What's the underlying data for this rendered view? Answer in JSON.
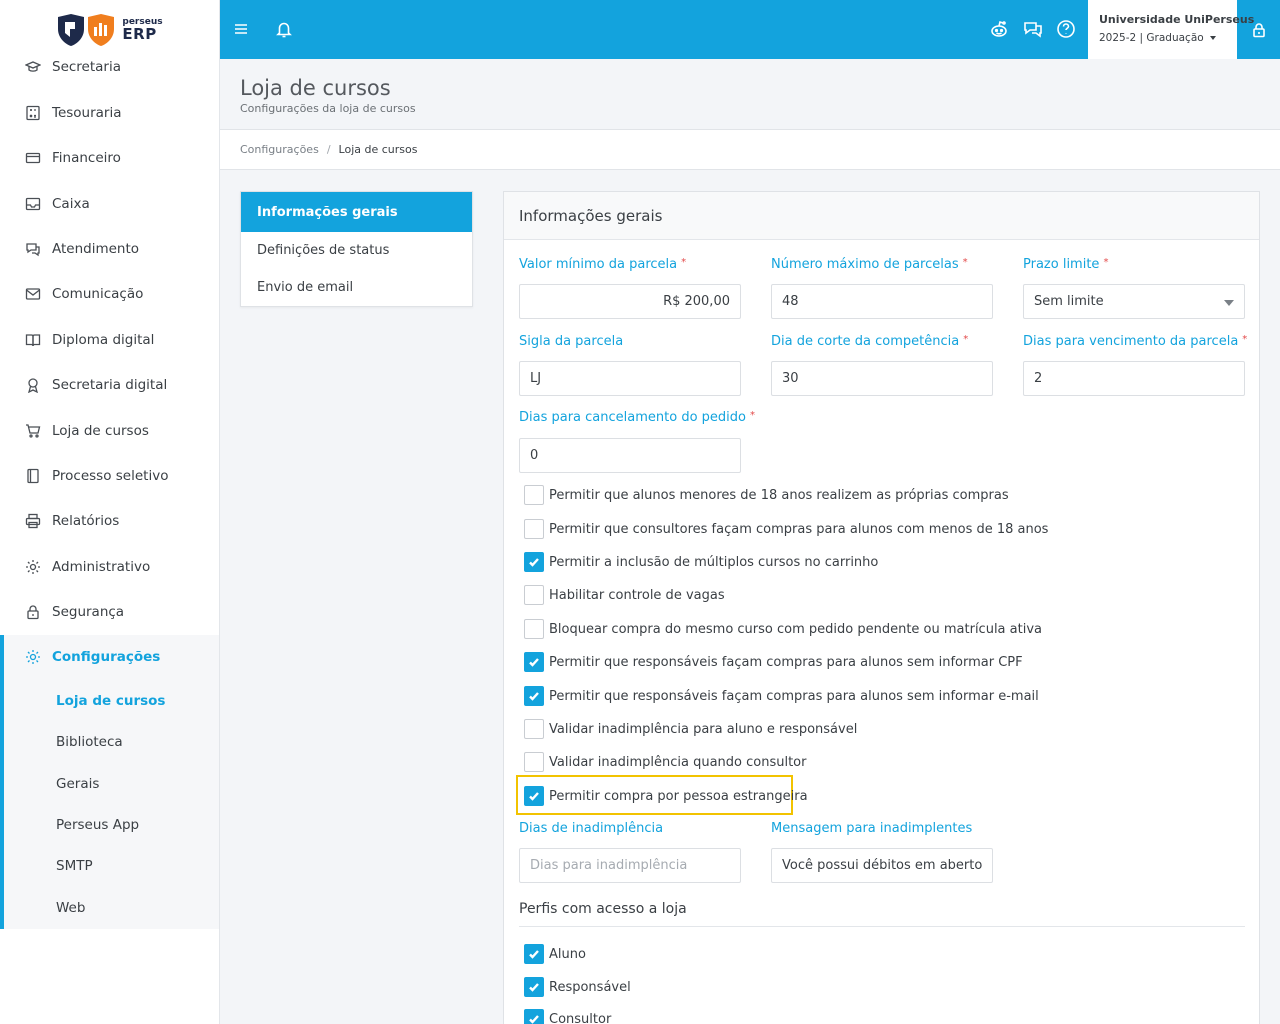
{
  "brand": {
    "small": "perseus",
    "big": "ERP"
  },
  "sidebar": {
    "items": [
      {
        "label": "Secretaria",
        "icon": "graduation-cap-icon"
      },
      {
        "label": "Tesouraria",
        "icon": "calculator-icon"
      },
      {
        "label": "Financeiro",
        "icon": "credit-card-icon"
      },
      {
        "label": "Caixa",
        "icon": "inbox-icon"
      },
      {
        "label": "Atendimento",
        "icon": "chat-icon"
      },
      {
        "label": "Comunicação",
        "icon": "envelope-icon"
      },
      {
        "label": "Diploma digital",
        "icon": "book-icon"
      },
      {
        "label": "Secretaria digital",
        "icon": "award-icon"
      },
      {
        "label": "Loja de cursos",
        "icon": "cart-icon"
      },
      {
        "label": "Processo seletivo",
        "icon": "notebook-icon"
      },
      {
        "label": "Relatórios",
        "icon": "printer-icon"
      },
      {
        "label": "Administrativo",
        "icon": "gear-icon"
      },
      {
        "label": "Segurança",
        "icon": "lock-icon"
      },
      {
        "label": "Configurações",
        "icon": "gear-icon"
      }
    ],
    "subitems": [
      "Loja de cursos",
      "Biblioteca",
      "Gerais",
      "Perseus App",
      "SMTP",
      "Web"
    ]
  },
  "topbar": {
    "university": "Universidade UniPerseus",
    "term": "2025-2 | Graduação"
  },
  "page": {
    "title": "Loja de cursos",
    "subtitle": "Configurações da loja de cursos"
  },
  "breadcrumb": {
    "parent": "Configurações",
    "current": "Loja de cursos"
  },
  "tabs": [
    "Informações gerais",
    "Definições de status",
    "Envio de email"
  ],
  "form": {
    "header": "Informações gerais",
    "fields": {
      "valor_minimo": {
        "label": "Valor mínimo da parcela",
        "value": "R$ 200,00"
      },
      "numero_maximo": {
        "label": "Número máximo de parcelas",
        "value": "48"
      },
      "prazo_limite": {
        "label": "Prazo limite",
        "value": "Sem limite"
      },
      "sigla": {
        "label": "Sigla da parcela",
        "value": "LJ"
      },
      "dia_corte": {
        "label": "Dia de corte da competência",
        "value": "30"
      },
      "dias_vencimento": {
        "label": "Dias para vencimento da parcela",
        "value": "2"
      },
      "dias_cancelamento": {
        "label": "Dias para cancelamento do pedido",
        "value": "0"
      },
      "dias_inadimplencia": {
        "label": "Dias de inadimplência",
        "value": "",
        "placeholder": "Dias para inadimplência"
      },
      "mensagem_inadimplentes": {
        "label": "Mensagem para inadimplentes",
        "value": "Você possui débitos em aberto, ..."
      }
    },
    "required_mark": "*",
    "checkboxes": [
      {
        "label": "Permitir que alunos menores de 18 anos realizem as próprias compras",
        "checked": false
      },
      {
        "label": "Permitir que consultores façam compras para alunos com menos de 18 anos",
        "checked": false
      },
      {
        "label": "Permitir a inclusão de múltiplos cursos no carrinho",
        "checked": true
      },
      {
        "label": "Habilitar controle de vagas",
        "checked": false
      },
      {
        "label": "Bloquear compra do mesmo curso com pedido pendente ou matrícula ativa",
        "checked": false
      },
      {
        "label": "Permitir que responsáveis façam compras para alunos sem informar CPF",
        "checked": true
      },
      {
        "label": "Permitir que responsáveis façam compras para alunos sem informar e-mail",
        "checked": true
      },
      {
        "label": "Validar inadimplência para aluno e responsável",
        "checked": false
      },
      {
        "label": "Validar inadimplência quando consultor",
        "checked": false
      },
      {
        "label": "Permitir compra por pessoa estrangeira",
        "checked": true
      }
    ],
    "profiles_title": "Perfis com acesso a loja",
    "profiles": [
      {
        "label": "Aluno",
        "checked": true
      },
      {
        "label": "Responsável",
        "checked": true
      },
      {
        "label": "Consultor",
        "checked": true
      }
    ]
  },
  "colors": {
    "accent": "#13a3dd",
    "highlight": "#f2c300",
    "required": "#e34a4a"
  }
}
